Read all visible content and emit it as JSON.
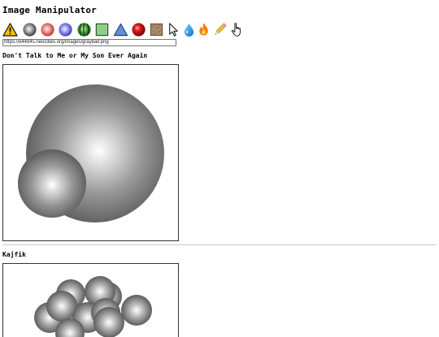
{
  "app": {
    "title": "Image Manipulator"
  },
  "toolbar": {
    "tools": [
      "warning-icon",
      "gray-ball-icon",
      "pink-ball-icon",
      "blue-ball-icon",
      "watermelon-icon",
      "green-square-icon",
      "blue-triangle-icon",
      "red-ball-icon",
      "texture-square-icon",
      "cursor-arrow-icon",
      "water-drop-icon",
      "fire-icon",
      "pencil-icon",
      "hand-pointer-icon"
    ]
  },
  "url_field": {
    "value": "https://e4494s.neocities.org/images/grayball.png"
  },
  "sections": [
    {
      "title": "Don't Talk to Me or My Son Ever Again"
    },
    {
      "title": "Kajfik"
    }
  ]
}
